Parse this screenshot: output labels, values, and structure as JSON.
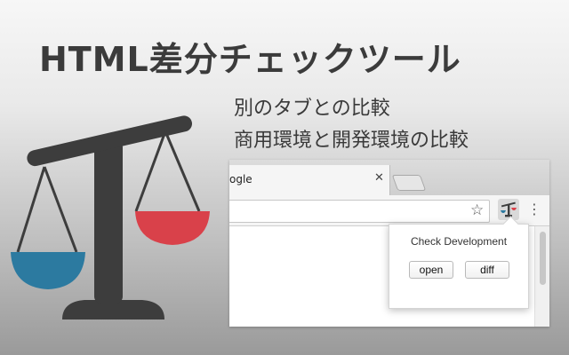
{
  "header": {
    "title": "HTML差分チェックツール",
    "subtitle_line1": "別のタブとの比較",
    "subtitle_line2": "商用環境と開発環境の比較"
  },
  "browser": {
    "tab_title": "ogle",
    "tab_close_glyph": "✕",
    "star_glyph": "☆",
    "menu_glyph": "⋮"
  },
  "popup": {
    "title": "Check Development",
    "open_label": "open",
    "diff_label": "diff"
  },
  "colors": {
    "scale_body": "#3d3d3d",
    "pan_left": "#2c7aa0",
    "pan_right": "#d9414a"
  },
  "icons": {
    "scale": "balance-scale-icon",
    "extension": "balance-scale-extension-icon"
  }
}
